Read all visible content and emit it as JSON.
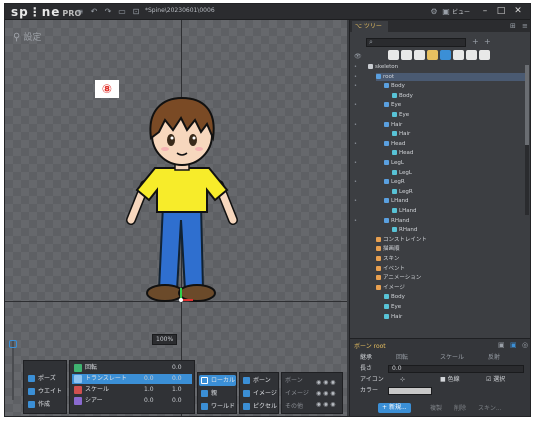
{
  "titlebar": {
    "logo": "sp⋮ne",
    "pro": "PRO",
    "file_title": "*Spine\\20230601\\0006",
    "view_button": "ビュー",
    "icons": [
      "menu-icon",
      "undo-icon",
      "redo-icon",
      "save-icon"
    ]
  },
  "viewport": {
    "mode_label": "設定",
    "badge": "⑧",
    "zoom": "100%"
  },
  "bottombar": {
    "modes": [
      {
        "label": "ポーズ",
        "color": "#3b8fd6"
      },
      {
        "label": "ウエイト",
        "color": "#3b8fd6"
      },
      {
        "label": "作成",
        "color": "#3b8fd6"
      }
    ],
    "tools": [
      {
        "label": "回転",
        "v1": "",
        "v2": "0.0"
      },
      {
        "label": "トランスレート",
        "v1": "0.0",
        "v2": "0.0"
      },
      {
        "label": "スケール",
        "v1": "1.0",
        "v2": "1.0"
      },
      {
        "label": "シアー",
        "v1": "0.0",
        "v2": "0.0"
      }
    ],
    "axes": [
      {
        "label": "ローカル"
      },
      {
        "label": "親"
      },
      {
        "label": "ワールド"
      }
    ],
    "compensate": [
      {
        "label": "ボーン"
      },
      {
        "label": "イメージ"
      },
      {
        "label": "ピクセル"
      }
    ],
    "options": [
      "ボーン",
      "イメージ",
      "その他"
    ]
  },
  "tree_panel": {
    "tab_label": "ツリー",
    "search_placeholder": "",
    "nodes": [
      {
        "label": "skeleton",
        "indent": 1,
        "type": "skeleton"
      },
      {
        "label": "root",
        "indent": 2,
        "type": "bone",
        "selected": true
      },
      {
        "label": "Body",
        "indent": 3,
        "type": "bone"
      },
      {
        "label": "Body",
        "indent": 4,
        "type": "slot"
      },
      {
        "label": "Eye",
        "indent": 3,
        "type": "bone"
      },
      {
        "label": "Eye",
        "indent": 4,
        "type": "slot"
      },
      {
        "label": "Hair",
        "indent": 3,
        "type": "bone"
      },
      {
        "label": "Hair",
        "indent": 4,
        "type": "slot"
      },
      {
        "label": "Head",
        "indent": 3,
        "type": "bone"
      },
      {
        "label": "Head",
        "indent": 4,
        "type": "slot"
      },
      {
        "label": "LegL",
        "indent": 3,
        "type": "bone"
      },
      {
        "label": "LegL",
        "indent": 4,
        "type": "slot"
      },
      {
        "label": "LegR",
        "indent": 3,
        "type": "bone"
      },
      {
        "label": "LegR",
        "indent": 4,
        "type": "slot"
      },
      {
        "label": "LHand",
        "indent": 3,
        "type": "bone"
      },
      {
        "label": "LHand",
        "indent": 4,
        "type": "slot"
      },
      {
        "label": "RHand",
        "indent": 3,
        "type": "bone"
      },
      {
        "label": "RHand",
        "indent": 4,
        "type": "slot"
      },
      {
        "label": "コンストレイント",
        "indent": 2,
        "type": "folder"
      },
      {
        "label": "描画順",
        "indent": 2,
        "type": "folder"
      },
      {
        "label": "スキン",
        "indent": 2,
        "type": "folder"
      },
      {
        "label": "イベント",
        "indent": 2,
        "type": "folder"
      },
      {
        "label": "アニメーション",
        "indent": 2,
        "type": "folder"
      },
      {
        "label": "イメージ",
        "indent": 2,
        "type": "folder"
      },
      {
        "label": "Body",
        "indent": 3,
        "type": "image"
      },
      {
        "label": "Eye",
        "indent": 3,
        "type": "image"
      },
      {
        "label": "Hair",
        "indent": 3,
        "type": "image"
      }
    ]
  },
  "props": {
    "title": "ボーン root",
    "rows": [
      {
        "label": "継承",
        "a": "回転",
        "b": "スケール",
        "c": "反射"
      },
      {
        "label": "長さ",
        "value": "0.0"
      },
      {
        "label": "アイコン",
        "color_label": "色線",
        "check_label": "選択"
      },
      {
        "label": "カラー",
        "value": ""
      }
    ],
    "new_button": "新規...",
    "buttons": [
      "複製",
      "削除",
      "スキン..."
    ]
  },
  "colors": {
    "accent": "#3b8fd6",
    "tab_active": "#e8c060",
    "bone": "#5aa0e0",
    "slot": "#58c3d6",
    "folder": "#e8a050"
  }
}
